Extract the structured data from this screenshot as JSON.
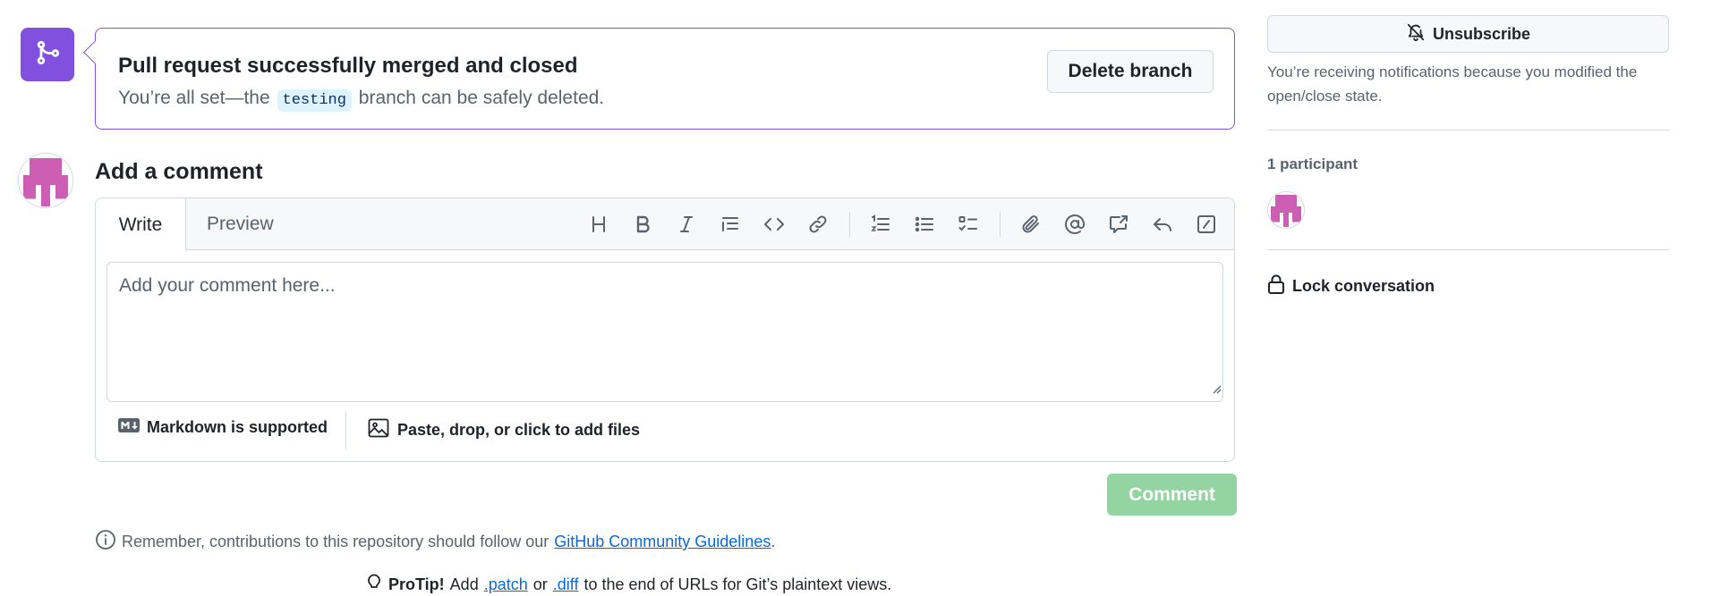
{
  "merge_banner": {
    "title": "Pull request successfully merged and closed",
    "subtitle_before": "You’re all set—the",
    "branch": "testing",
    "subtitle_after": "branch can be safely deleted.",
    "delete_button": "Delete branch",
    "icon": "git-merge-icon"
  },
  "comment": {
    "heading": "Add a comment",
    "tabs": [
      {
        "label": "Write",
        "selected": true
      },
      {
        "label": "Preview",
        "selected": false
      }
    ],
    "toolbar_icons": [
      "heading-icon",
      "bold-icon",
      "italic-icon",
      "quote-icon",
      "code-icon",
      "link-icon",
      "ordered-list-icon",
      "unordered-list-icon",
      "task-list-icon",
      "attach-icon",
      "mention-icon",
      "reference-icon",
      "saved-replies-icon",
      "slash-commands-icon"
    ],
    "placeholder": "Add your comment here...",
    "markdown_label": "Markdown is supported",
    "files_label": "Paste, drop, or click to add files",
    "submit_label": "Comment"
  },
  "guidelines": {
    "text_before": "Remember, contributions to this repository should follow our",
    "link": "GitHub Community Guidelines",
    "text_after": "."
  },
  "protip": {
    "bold": "ProTip!",
    "text_1": "Add",
    "link_1": ".patch",
    "text_2": "or",
    "link_2": ".diff",
    "text_3": "to the end of URLs for Git’s plaintext views."
  },
  "sidebar": {
    "unsubscribe_label": "Unsubscribe",
    "notification_text": "You’re receiving notifications because you modified the open/close state.",
    "participants_label": "1 participant",
    "lock_label": "Lock conversation"
  },
  "colors": {
    "merged_purple": "#8250df",
    "comment_button_disabled": "#94d3a2",
    "avatar_pink": "#cc5fb4",
    "link_blue": "#0969da"
  }
}
